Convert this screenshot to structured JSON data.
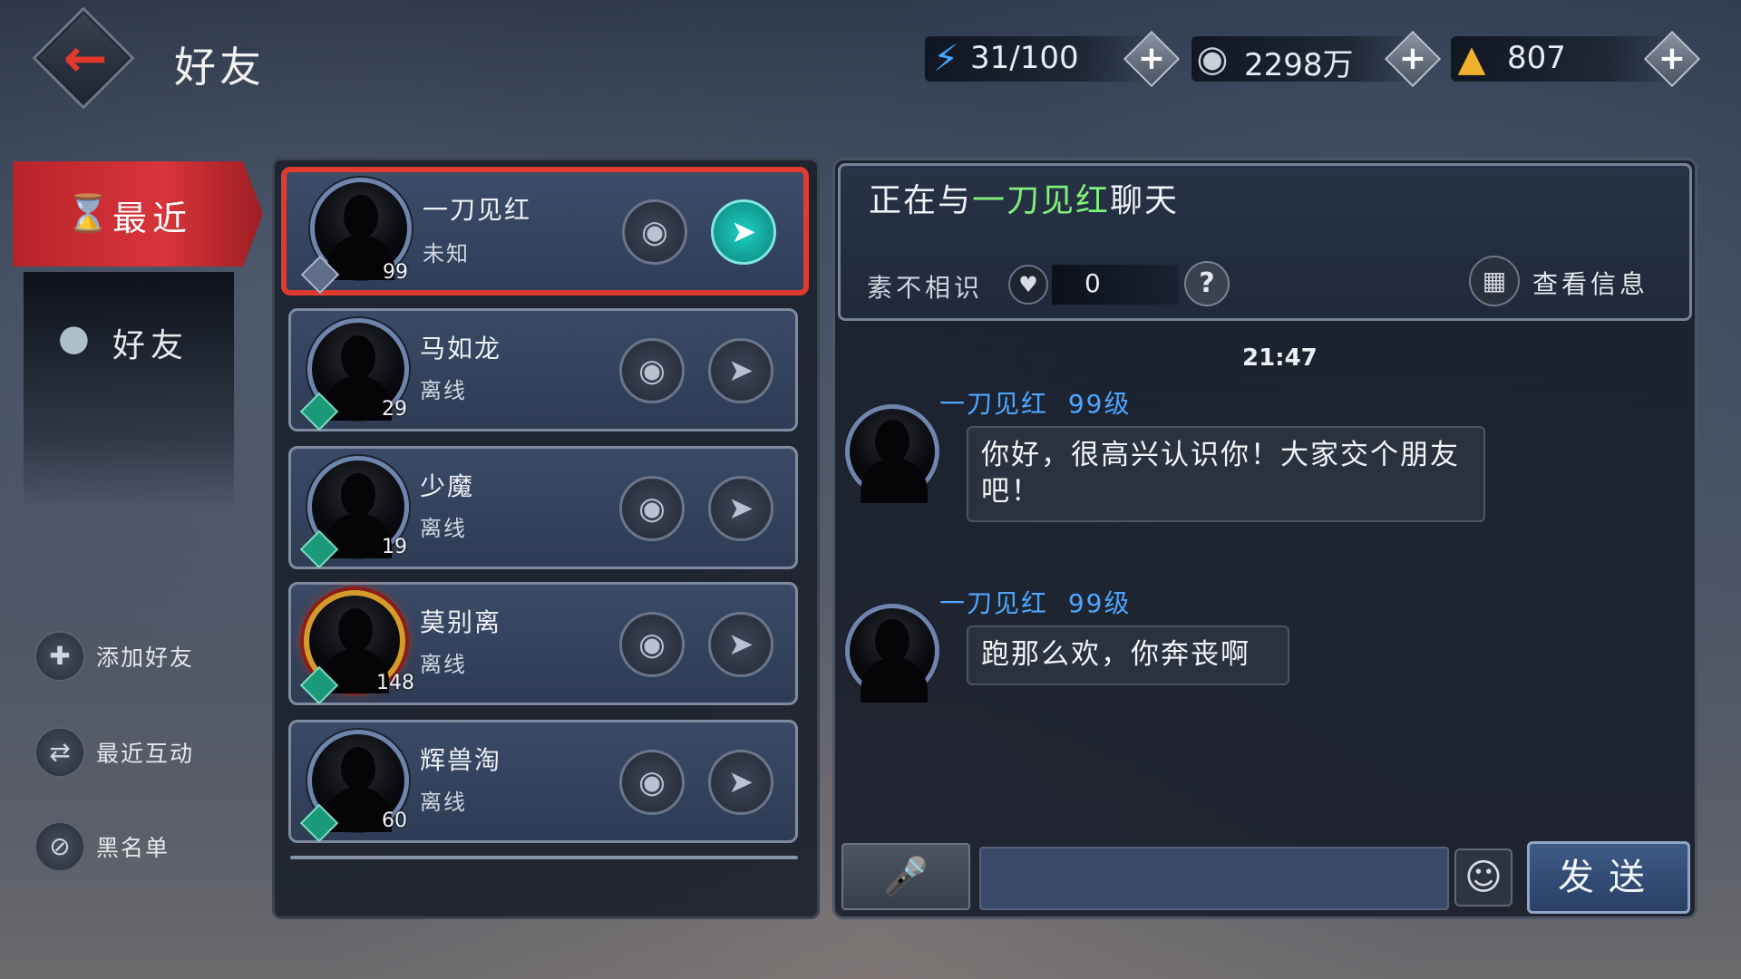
{
  "header": {
    "title": "好友",
    "resources": [
      {
        "icon": "lightning-icon",
        "value": "31/100"
      },
      {
        "icon": "coin-icon",
        "value": "2298万"
      },
      {
        "icon": "gold-ingot-icon",
        "value": "807"
      }
    ]
  },
  "nav": {
    "recent": "最近",
    "friends": "好友",
    "actions": [
      {
        "label": "添加好友",
        "icon": "add-friend-icon"
      },
      {
        "label": "最近互动",
        "icon": "interaction-icon"
      },
      {
        "label": "黑名单",
        "icon": "blacklist-icon"
      }
    ]
  },
  "friends": [
    {
      "name": "一刀见红",
      "status": "未知",
      "level": "99",
      "selected": true
    },
    {
      "name": "马如龙",
      "status": "离线",
      "level": "29"
    },
    {
      "name": "少魔",
      "status": "离线",
      "level": "19"
    },
    {
      "name": "莫别离",
      "status": "离线",
      "level": "148"
    },
    {
      "name": "辉兽淘",
      "status": "离线",
      "level": "60"
    }
  ],
  "chat": {
    "title_prefix": "正在与",
    "title_name": "一刀见红",
    "title_suffix": "聊天",
    "relation_label": "素不相识",
    "relation_value": "0",
    "help": "?",
    "info_label": "查看信息",
    "timestamp": "21:47",
    "messages": [
      {
        "sender": "一刀见红",
        "level": "99级",
        "text": "你好，很高兴认识你！大家交个朋友吧！"
      },
      {
        "sender": "一刀见红",
        "level": "99级",
        "text": "跑那么欢，你奔丧啊"
      }
    ],
    "input_placeholder": "",
    "send_label": "发送"
  }
}
